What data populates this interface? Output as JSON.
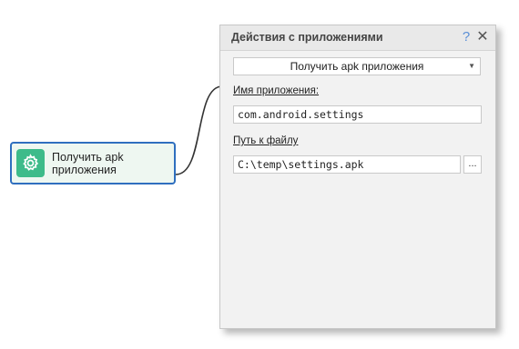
{
  "node": {
    "label": "Получить apk приложения",
    "icon": "gear-icon",
    "icon_color": "#3dbb8a",
    "border_color": "#2f6fbf"
  },
  "panel": {
    "title": "Действия с приложениями",
    "help_label": "?",
    "close_label": "✕",
    "action_select": {
      "value": "Получить apk приложения"
    },
    "app_name_label": "Имя приложения:",
    "app_name_value": "com.android.settings",
    "file_path_label": "Путь к файлу",
    "file_path_value": "C:\\temp\\settings.apk",
    "browse_label": "..."
  }
}
